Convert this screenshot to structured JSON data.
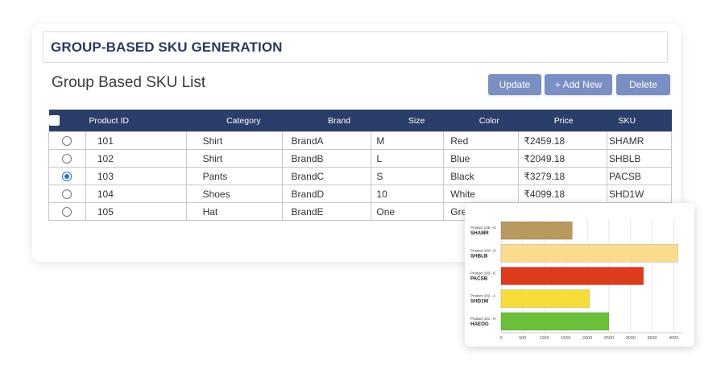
{
  "header": {
    "title": "GROUP-BASED SKU GENERATION"
  },
  "list": {
    "title": "Group Based SKU List"
  },
  "buttons": {
    "update": "Update",
    "add_new": "+ Add New",
    "delete": "Delete"
  },
  "table": {
    "columns": [
      "Product ID",
      "Category",
      "Brand",
      "Size",
      "Color",
      "Price",
      "SKU"
    ],
    "rows": [
      {
        "id": "101",
        "category": "Shirt",
        "brand": "BrandA",
        "size": "M",
        "color": "Red",
        "price": "₹2459.18",
        "sku": "SHAMR",
        "selected": false
      },
      {
        "id": "102",
        "category": "Shirt",
        "brand": "BrandB",
        "size": "L",
        "color": "Blue",
        "price": "₹2049.18",
        "sku": "SHBLB",
        "selected": false
      },
      {
        "id": "103",
        "category": "Pants",
        "brand": "BrandC",
        "size": "S",
        "color": "Black",
        "price": "₹3279.18",
        "sku": "PACSB",
        "selected": true
      },
      {
        "id": "104",
        "category": "Shoes",
        "brand": "BrandD",
        "size": "10",
        "color": "White",
        "price": "₹4099.18",
        "sku": "SHD1W",
        "selected": false
      },
      {
        "id": "105",
        "category": "Hat",
        "brand": "BrandE",
        "size": "One",
        "color": "Gre",
        "price": "",
        "sku": "",
        "selected": false
      }
    ]
  },
  "chart_data": {
    "type": "bar",
    "orientation": "horizontal",
    "categories": [
      {
        "prefix": "Product 105 - G",
        "sku": "SHAMR"
      },
      {
        "prefix": "Product 104 - O",
        "sku": "SHBLB"
      },
      {
        "prefix": "Product 103 - E",
        "sku": "PACSB"
      },
      {
        "prefix": "Product 102 - A",
        "sku": "SHD1W"
      },
      {
        "prefix": "Product 101 - H",
        "sku": "HAEOG"
      }
    ],
    "values": [
      1650,
      4100,
      3300,
      2050,
      2500
    ],
    "colors": [
      "#b89a5e",
      "#fbdc8f",
      "#dd3b1e",
      "#f6dd3a",
      "#6cbf3a"
    ],
    "xlim": [
      0,
      4200
    ],
    "xticks": [
      0,
      500,
      1000,
      1500,
      2000,
      2500,
      3000,
      3500,
      4000
    ],
    "grid": true
  }
}
